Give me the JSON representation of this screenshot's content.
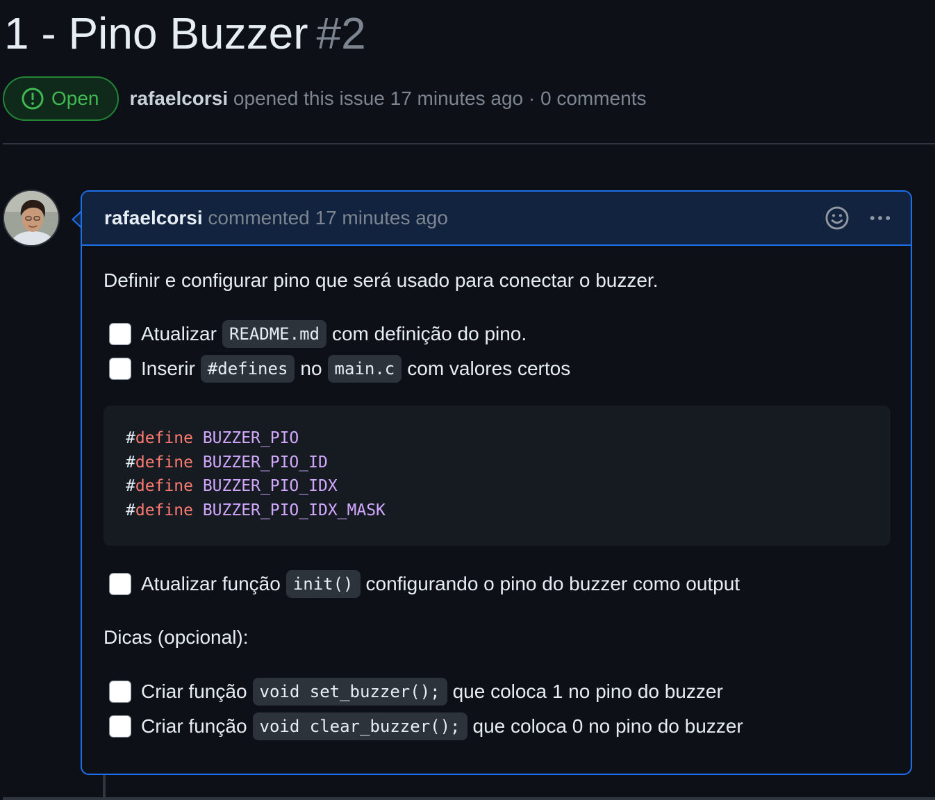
{
  "issue": {
    "title": "1 - Pino Buzzer",
    "number": "#2",
    "state": "Open",
    "author": "rafaelcorsi",
    "meta": "opened this issue 17 minutes ago · 0 comments"
  },
  "comment": {
    "author": "rafaelcorsi",
    "action": "commented 17 minutes ago",
    "intro": "Definir e configurar pino que será usado para conectar o buzzer.",
    "tasks1": [
      {
        "before": "Atualizar",
        "code": "README.md",
        "after": "com definição do pino.",
        "checked": false
      },
      {
        "before": "Inserir",
        "code": "#defines",
        "middle": "no",
        "code2": "main.c",
        "after": "com valores certos",
        "checked": false
      }
    ],
    "code_lines": [
      {
        "hash": "#",
        "keyword": "define",
        "name": "BUZZER_PIO"
      },
      {
        "hash": "#",
        "keyword": "define",
        "name": "BUZZER_PIO_ID"
      },
      {
        "hash": "#",
        "keyword": "define",
        "name": "BUZZER_PIO_IDX"
      },
      {
        "hash": "#",
        "keyword": "define",
        "name": "BUZZER_PIO_IDX_MASK"
      }
    ],
    "task3": {
      "before": "Atualizar função",
      "code": "init()",
      "after": "configurando o pino do buzzer como output",
      "checked": false
    },
    "tips_heading": "Dicas (opcional):",
    "tasks2": [
      {
        "before": "Criar função",
        "code": "void set_buzzer();",
        "after": "que coloca 1 no pino do buzzer",
        "checked": false
      },
      {
        "before": "Criar função",
        "code": "void clear_buzzer();",
        "after": "que coloca 0 no pino do buzzer",
        "checked": false
      }
    ]
  },
  "icons": {
    "state": "issue-opened-icon",
    "reaction": "smiley-icon",
    "more": "kebab-horizontal-icon"
  },
  "colors": {
    "background": "#0d1117",
    "open_green": "#3fb950",
    "border_blue": "#1f6feb",
    "header_bg": "#11233e",
    "code_keyword": "#ff7b72",
    "code_name": "#d2a8ff"
  }
}
